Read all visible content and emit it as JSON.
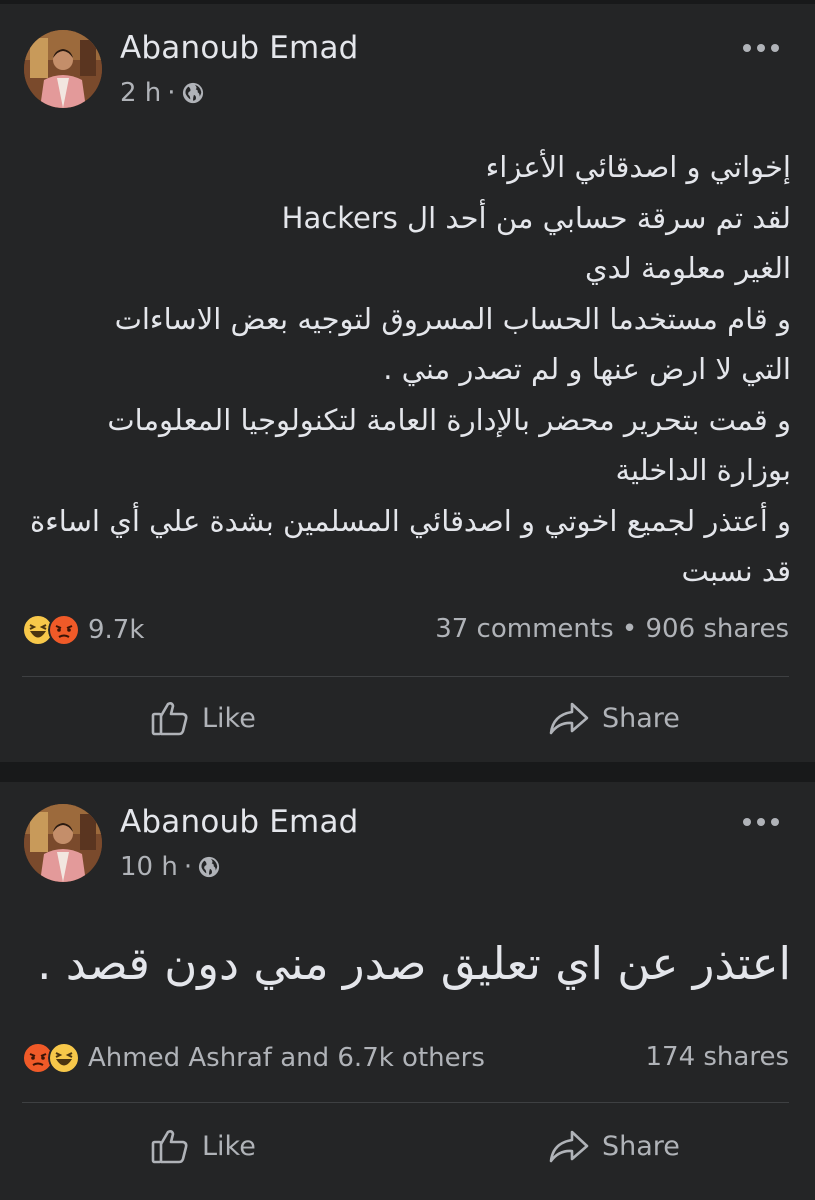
{
  "posts": [
    {
      "author": "Abanoub Emad",
      "time": "2 h",
      "separator": "·",
      "privacy_icon": "globe-icon",
      "body_lines": [
        "إخواتي و اصدقائي الأعزاء",
        "لقد تم سرقة حسابي من أحد ال Hackers",
        "الغير معلومة لدي",
        "و قام مستخدما الحساب المسروق لتوجيه بعض الاساءات",
        "التي لا ارض عنها و لم تصدر مني .",
        "و قمت بتحرير محضر بالإدارة العامة لتكنولوجيا المعلومات",
        "بوزارة الداخلية",
        "و أعتذر لجميع اخوتي و اصدقائي المسلمين بشدة علي أي اساءة",
        "قد نسبت"
      ],
      "reaction_icons": [
        "haha-reaction-icon",
        "angry-reaction-icon"
      ],
      "reaction_count": "9.7k",
      "stats": "37 comments • 906 shares",
      "like_label": "Like",
      "share_label": "Share"
    },
    {
      "author": "Abanoub Emad",
      "time": "10 h",
      "separator": "·",
      "privacy_icon": "globe-icon",
      "body_lines": [
        "اعتذر عن اي تعليق صدر مني دون قصد ."
      ],
      "reaction_icons": [
        "angry-reaction-icon",
        "haha-reaction-icon"
      ],
      "reaction_count": "Ahmed Ashraf and 6.7k others",
      "stats": "174 shares",
      "like_label": "Like",
      "share_label": "Share"
    }
  ],
  "colors": {
    "background": "#18191a",
    "card": "#242526",
    "primary_text": "#e4e6eb",
    "secondary_text": "#b0b3b8",
    "divider": "#3e4042"
  }
}
